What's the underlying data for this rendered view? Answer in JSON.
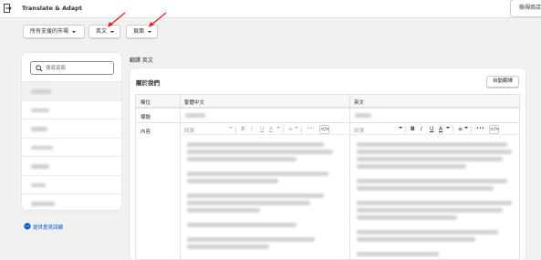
{
  "topbar": {
    "title": "Translate & Adapt",
    "view_store": "檢視商店"
  },
  "filters": {
    "market": "所有支援的市場",
    "language": "英文",
    "resource": "頁面"
  },
  "sidebar": {
    "search_placeholder": "搜尋頁面",
    "feedback": "提供意見回饋"
  },
  "main": {
    "translate_label": "翻譯 英文",
    "card_title": "關於我們",
    "auto_translate": "自動翻譯",
    "columns": {
      "field": "欄位",
      "source": "繁體中文",
      "target": "英文"
    },
    "rows": {
      "title": "標題",
      "content": "內容"
    },
    "editor": {
      "paragraph": "段落",
      "bold": "B",
      "italic": "I",
      "underline": "U",
      "text_color": "A",
      "align": "≡",
      "more": "•••",
      "code": "</>"
    }
  },
  "colors": {
    "annotation_arrow": "#e02020",
    "link": "#005bd3"
  }
}
